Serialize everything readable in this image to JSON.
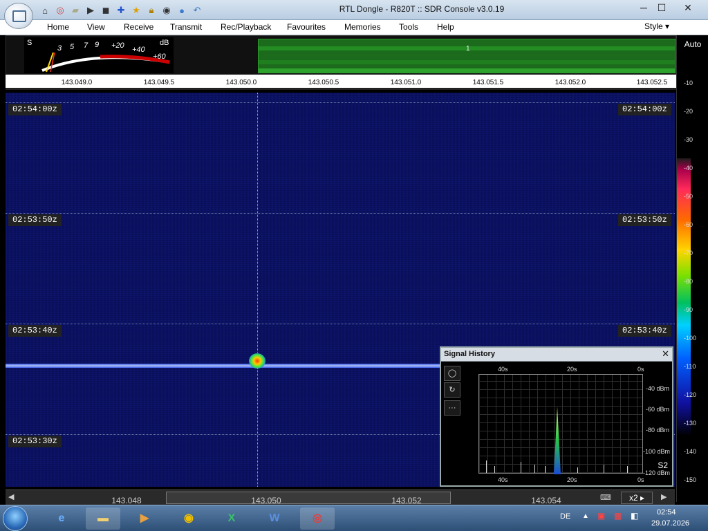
{
  "window": {
    "title": "RTL Dongle - R820T :: SDR Console v3.0.19",
    "minimize": "─",
    "maximize": "☐",
    "close": "✕"
  },
  "menu": {
    "items": [
      "Home",
      "View",
      "Receive",
      "Transmit",
      "Rec/Playback",
      "Favourites",
      "Memories",
      "Tools",
      "Help"
    ],
    "style_label": "Style"
  },
  "meter": {
    "s_label": "S",
    "db_label": "dB",
    "scale_s": [
      "3",
      "5",
      "7",
      "9"
    ],
    "scale_plus": [
      "+20",
      "+40",
      "+60"
    ],
    "marker_label": "1"
  },
  "frequency_scale": {
    "labels": [
      "143.049.0",
      "143.049.5",
      "143.050.0",
      "143.050.5",
      "143.051.0",
      "143.051.5",
      "143.052.0",
      "143.052.5"
    ]
  },
  "waterfall": {
    "times": [
      "02:54:00z",
      "02:53:50z",
      "02:53:40z",
      "02:53:30z"
    ]
  },
  "signal_history": {
    "title": "Signal History",
    "close": "✕",
    "time_labels_top": [
      "40s",
      "20s",
      "0s"
    ],
    "time_labels_bottom": [
      "40s",
      "20s",
      "0s"
    ],
    "dbm_labels": [
      "-40 dBm",
      "-60 dBm",
      "-80 dBm",
      "-100 dBm",
      "-120 dBm"
    ],
    "reading": "S2",
    "buttons": [
      "◯",
      "↻",
      "···"
    ]
  },
  "db_scale": {
    "auto_label": "Auto",
    "labels": [
      "-10",
      "-20",
      "-30",
      "-40",
      "-50",
      "-60",
      "-70",
      "-80",
      "-90",
      "-100",
      "-110",
      "-120",
      "-130",
      "-140",
      "-150"
    ]
  },
  "bottom_bar": {
    "labels": [
      "143.048",
      "143.050",
      "143.052",
      "143.054"
    ],
    "zoom": "x2"
  },
  "taskbar": {
    "language": "DE",
    "time": "02:54",
    "date": "29.07.2026"
  },
  "colors": {
    "waterfall_bg": "#0a0f5a",
    "spectrum_green": "#1c6a1c",
    "signal_peak": "#ff3a00"
  }
}
